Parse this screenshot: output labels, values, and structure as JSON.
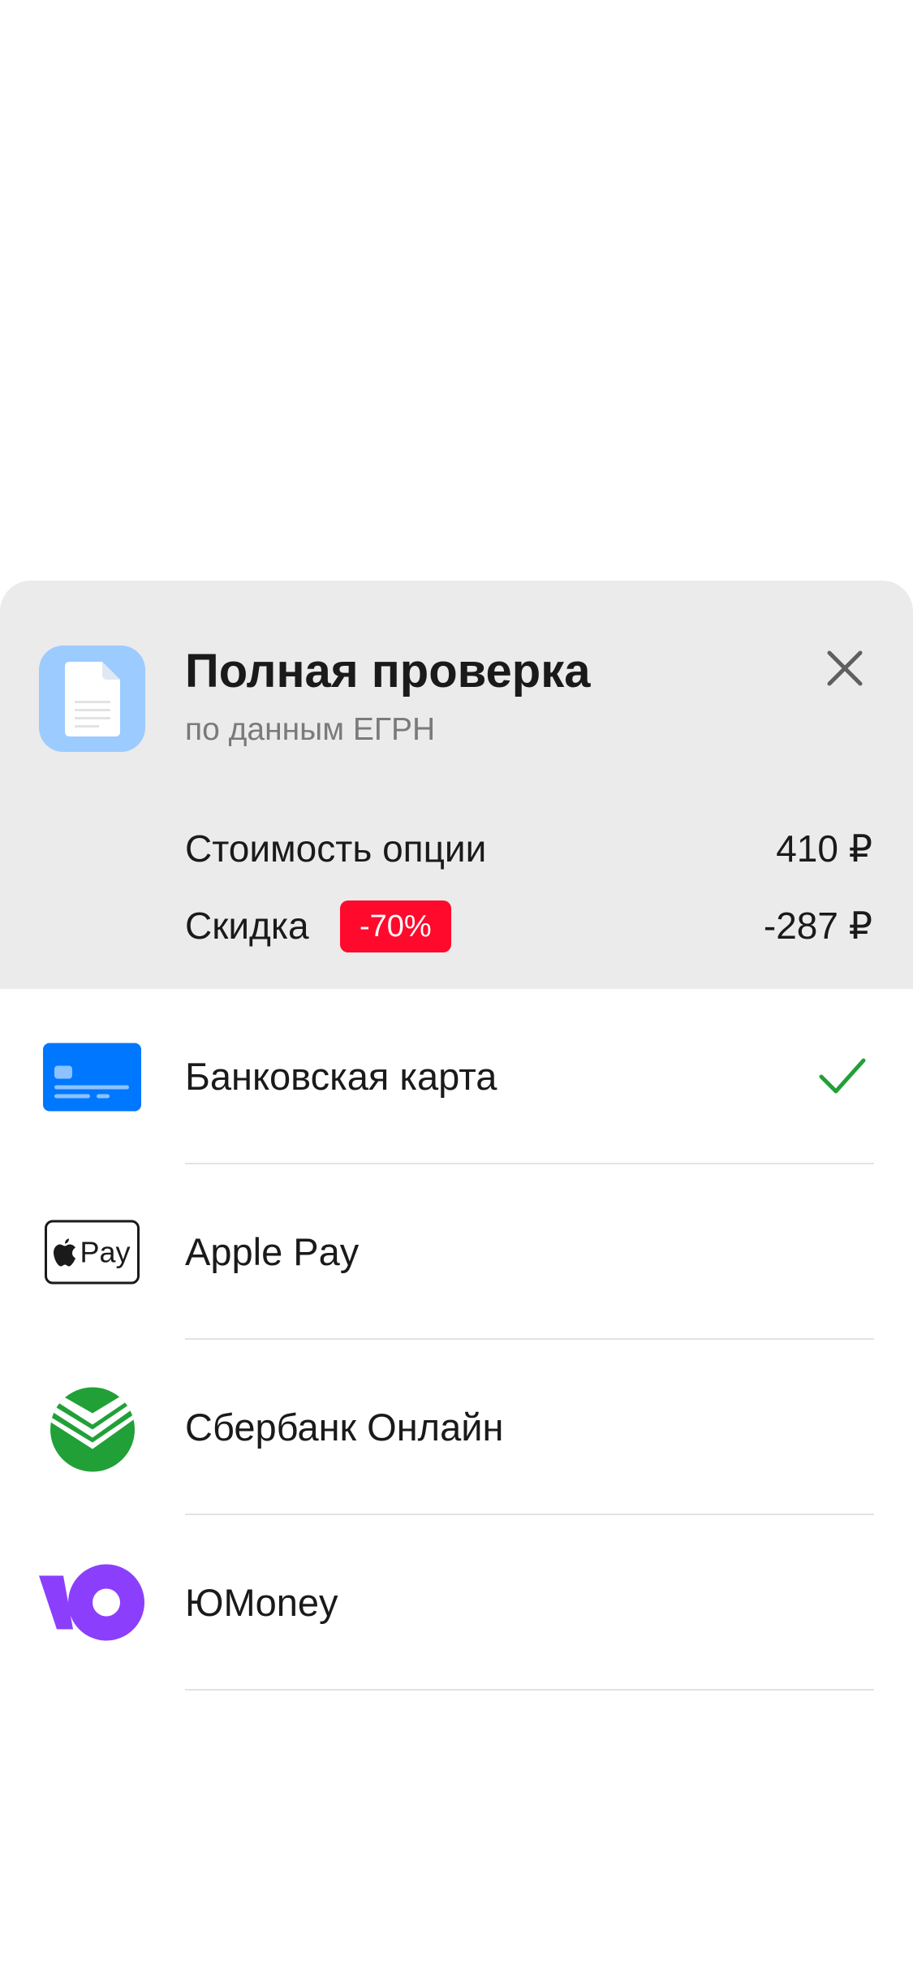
{
  "product": {
    "icon": "document-icon",
    "title": "Полная проверка",
    "subtitle": "по данным ЕГРН"
  },
  "pricing": {
    "option_cost_label": "Стоимость опции",
    "option_cost_value": "410 ₽",
    "discount_label": "Скидка",
    "discount_badge": "-70%",
    "discount_value": "-287 ₽"
  },
  "payment_methods": [
    {
      "label": "Банковская карта",
      "icon": "bank-card-icon",
      "selected": true
    },
    {
      "label": "Apple Pay",
      "icon": "apple-pay-icon",
      "icon_text": "Pay",
      "selected": false
    },
    {
      "label": "Сбербанк Онлайн",
      "icon": "sberbank-icon",
      "selected": false
    },
    {
      "label": "ЮMoney",
      "icon": "yoomoney-icon",
      "selected": false
    }
  ],
  "colors": {
    "header_bg": "#ebebeb",
    "product_icon_bg": "#9ccbff",
    "discount_badge": "#ff0a2c",
    "check": "#21a038",
    "bank_card": "#0077ff",
    "sberbank": "#21a038",
    "yoomoney": "#8b3ffd"
  }
}
